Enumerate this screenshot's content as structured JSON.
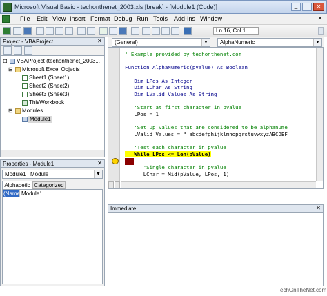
{
  "window": {
    "title": "Microsoft Visual Basic - techonthenet_2003.xls [break] - [Module1 (Code)]"
  },
  "menu": [
    "File",
    "Edit",
    "View",
    "Insert",
    "Format",
    "Debug",
    "Run",
    "Tools",
    "Add-Ins",
    "Window"
  ],
  "toolbar": {
    "position": "Ln 16, Col 1"
  },
  "project": {
    "title": "Project - VBAProject",
    "root": "VBAProject (techonthenet_2003...",
    "excel_objects": "Microsoft Excel Objects",
    "sheets": [
      "Sheet1 (Sheet1)",
      "Sheet2 (Sheet2)",
      "Sheet3 (Sheet3)",
      "ThisWorkbook"
    ],
    "modules": "Modules",
    "module": "Module1"
  },
  "properties": {
    "title": "Properties - Module1",
    "object": "Module1",
    "object_type": "Module",
    "tabs": [
      "Alphabetic",
      "Categorized"
    ],
    "prop_name": "(Name)",
    "prop_value": "Module1"
  },
  "code": {
    "object_dropdown": "(General)",
    "proc_dropdown": "AlphaNumeric",
    "lines": [
      {
        "text": "' Example provided by techonthenet.com",
        "kind": "cm"
      },
      {
        "text": "",
        "kind": "n"
      },
      {
        "text": "Function AlphaNumeric(pValue) As Boolean",
        "kind": "kw"
      },
      {
        "text": "",
        "kind": "n"
      },
      {
        "text": "   Dim LPos As Integer",
        "kind": "kw"
      },
      {
        "text": "   Dim LChar As String",
        "kind": "kw"
      },
      {
        "text": "   Dim LValid_Values As String",
        "kind": "kw"
      },
      {
        "text": "",
        "kind": "n"
      },
      {
        "text": "   'Start at first character in pValue",
        "kind": "cm"
      },
      {
        "text": "   LPos = 1",
        "kind": "n"
      },
      {
        "text": "",
        "kind": "n"
      },
      {
        "text": "   'Set up values that are considered to be alphanume",
        "kind": "cm"
      },
      {
        "text": "   LValid_Values = \" abcdefghijklmnopqrstuvwxyzABCDEF",
        "kind": "n"
      },
      {
        "text": "",
        "kind": "n"
      },
      {
        "text": "   'Test each character in pValue",
        "kind": "cm"
      },
      {
        "text": "   While LPos <= Len(pValue)",
        "kind": "hl"
      },
      {
        "text": "",
        "kind": "n"
      },
      {
        "text": "      'Single character in pValue",
        "kind": "cm"
      },
      {
        "text": "      LChar = Mid(pValue, LPos, 1)",
        "kind": "n"
      }
    ]
  },
  "immediate": {
    "title": "Immediate"
  },
  "watermark": "TechOnTheNet.com",
  "colors": {
    "highlight": "#ffff00",
    "breakpoint": "#8b0000",
    "comment": "#008000",
    "keyword": "#00008b"
  }
}
